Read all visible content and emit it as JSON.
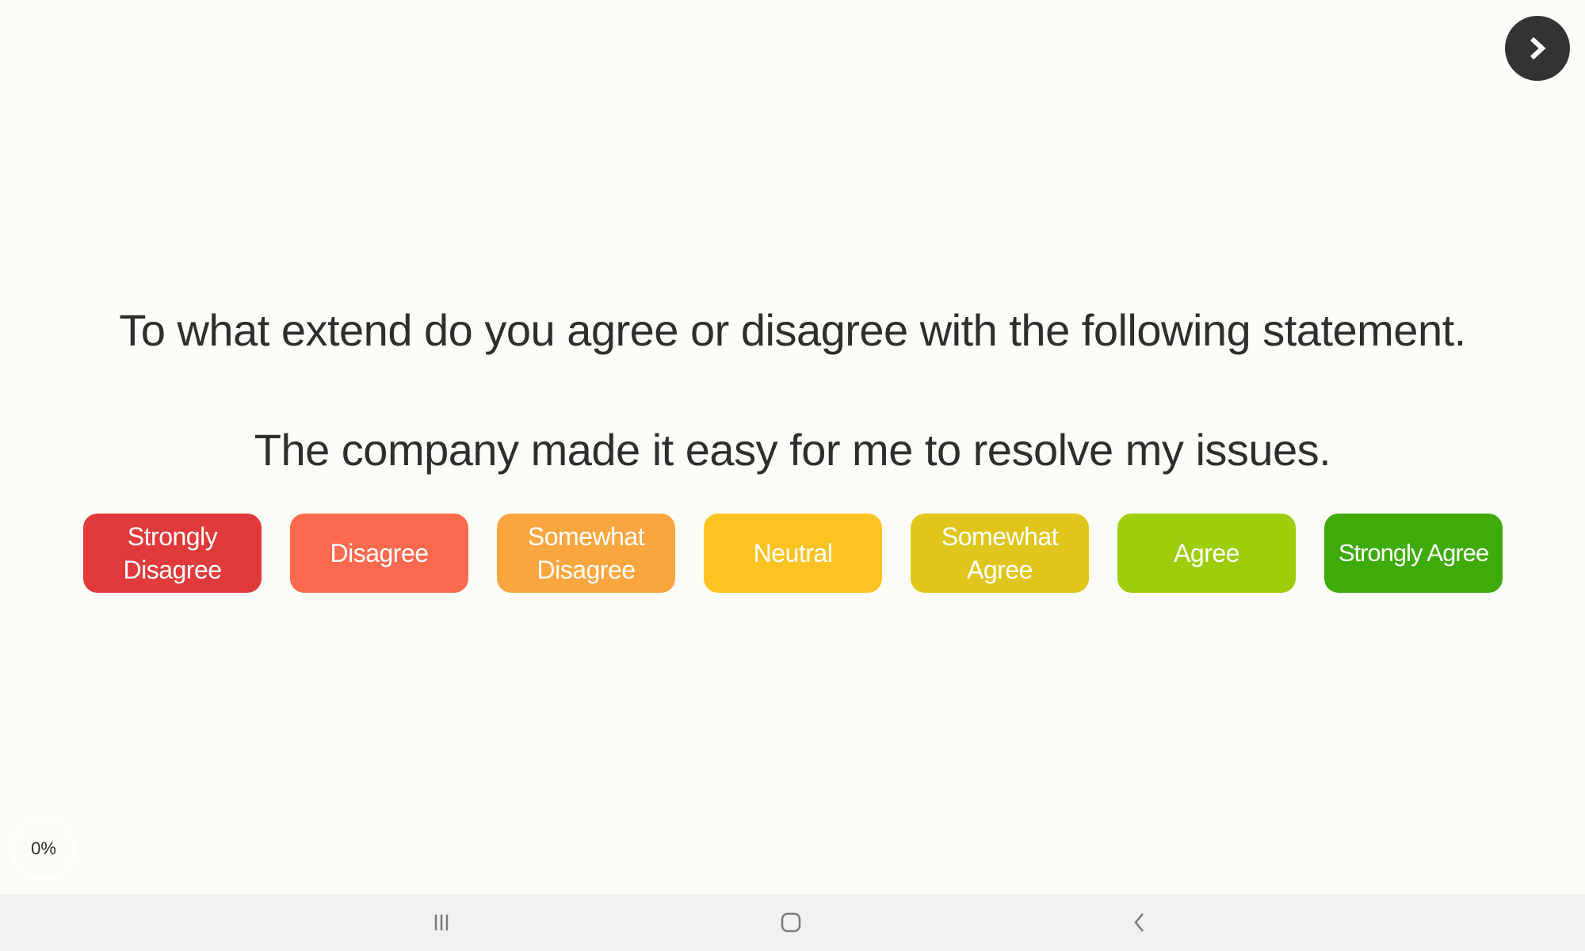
{
  "navigation": {
    "next_icon": "chevron-right-icon"
  },
  "question": {
    "prompt": "To what extend do you agree or disagree with the following statement.",
    "statement": "The company made it easy for me to resolve my issues."
  },
  "options": [
    {
      "label": "Strongly Disagree",
      "color": "#e03a3a"
    },
    {
      "label": "Disagree",
      "color": "#fb6a4e"
    },
    {
      "label": "Somewhat Disagree",
      "color": "#fca63f"
    },
    {
      "label": "Neutral",
      "color": "#fdc323"
    },
    {
      "label": "Somewhat Agree",
      "color": "#e0c61c"
    },
    {
      "label": "Agree",
      "color": "#9ecd0b"
    },
    {
      "label": "Strongly Agree",
      "color": "#3eab08"
    }
  ],
  "progress": {
    "label": "0%",
    "value": 0
  },
  "system_nav": {
    "recents_icon": "recents-icon",
    "home_icon": "home-icon",
    "back_icon": "back-icon"
  }
}
